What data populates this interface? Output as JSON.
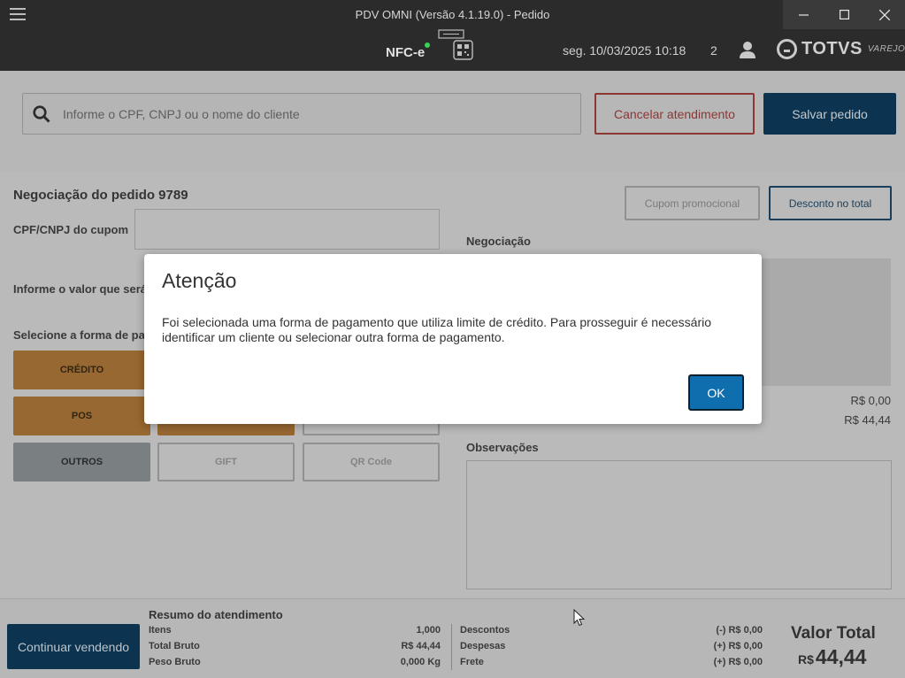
{
  "window": {
    "title": "PDV OMNI (Versão 4.1.19.0) - Pedido"
  },
  "header": {
    "nfce_label": "NFC-e",
    "datetime": "seg. 10/03/2025 10:18",
    "count": "2",
    "logo_text": "TOTVS",
    "logo_sub": "VAREJO"
  },
  "search": {
    "placeholder": "Informe o CPF, CNPJ ou o nome do cliente"
  },
  "actions": {
    "cancel_label": "Cancelar atendimento",
    "save_label": "Salvar pedido"
  },
  "negotiation": {
    "title": "Negociação do pedido 9789",
    "cpf_label": "CPF/CNPJ do cupom",
    "valor_label": "Informe o valor que será",
    "forma_label": "Selecione a forma de pa",
    "promo_label": "Cupom promocional",
    "desconto_label": "Desconto no total",
    "section_label": "Negociação",
    "value_1": "R$ 0,00",
    "value_2": "R$ 44,44",
    "obs_label": "Observações"
  },
  "payment_buttons": [
    {
      "label": "CRÉDITO",
      "style": "orange"
    },
    {
      "label": "POS",
      "style": "orange"
    },
    {
      "label": "",
      "style": "orange"
    },
    {
      "label": "",
      "style": "outline"
    },
    {
      "label": "OUTROS",
      "style": "gray"
    },
    {
      "label": "GIFT",
      "style": "outline"
    },
    {
      "label": "QR Code",
      "style": "outline"
    }
  ],
  "footer": {
    "continuar_label": "Continuar vendendo",
    "resumo_title": "Resumo do atendimento",
    "left": [
      {
        "label": "Itens",
        "value": "1,000"
      },
      {
        "label": "Total Bruto",
        "value": "R$ 44,44"
      },
      {
        "label": "Peso Bruto",
        "value": "0,000 Kg"
      }
    ],
    "right": [
      {
        "label": "Descontos",
        "value": "(-) R$ 0,00"
      },
      {
        "label": "Despesas",
        "value": "(+) R$ 0,00"
      },
      {
        "label": "Frete",
        "value": "(+) R$ 0,00"
      }
    ],
    "valor_total_label": "Valor Total",
    "valor_total_currency": "R$",
    "valor_total_value": "44,44"
  },
  "dialog": {
    "title": "Atenção",
    "message": "Foi selecionada uma forma de pagamento que utiliza limite de crédito. Para prosseguir é necessário identificar um cliente ou selecionar outra forma de pagamento.",
    "ok_label": "OK"
  },
  "colors": {
    "header_bg": "#2b2b2b",
    "primary": "#0e3d5e",
    "danger": "#a4403d",
    "dialog_ok": "#0f6fae",
    "pay_orange": "#b07a3a",
    "status_green": "#39d353"
  }
}
